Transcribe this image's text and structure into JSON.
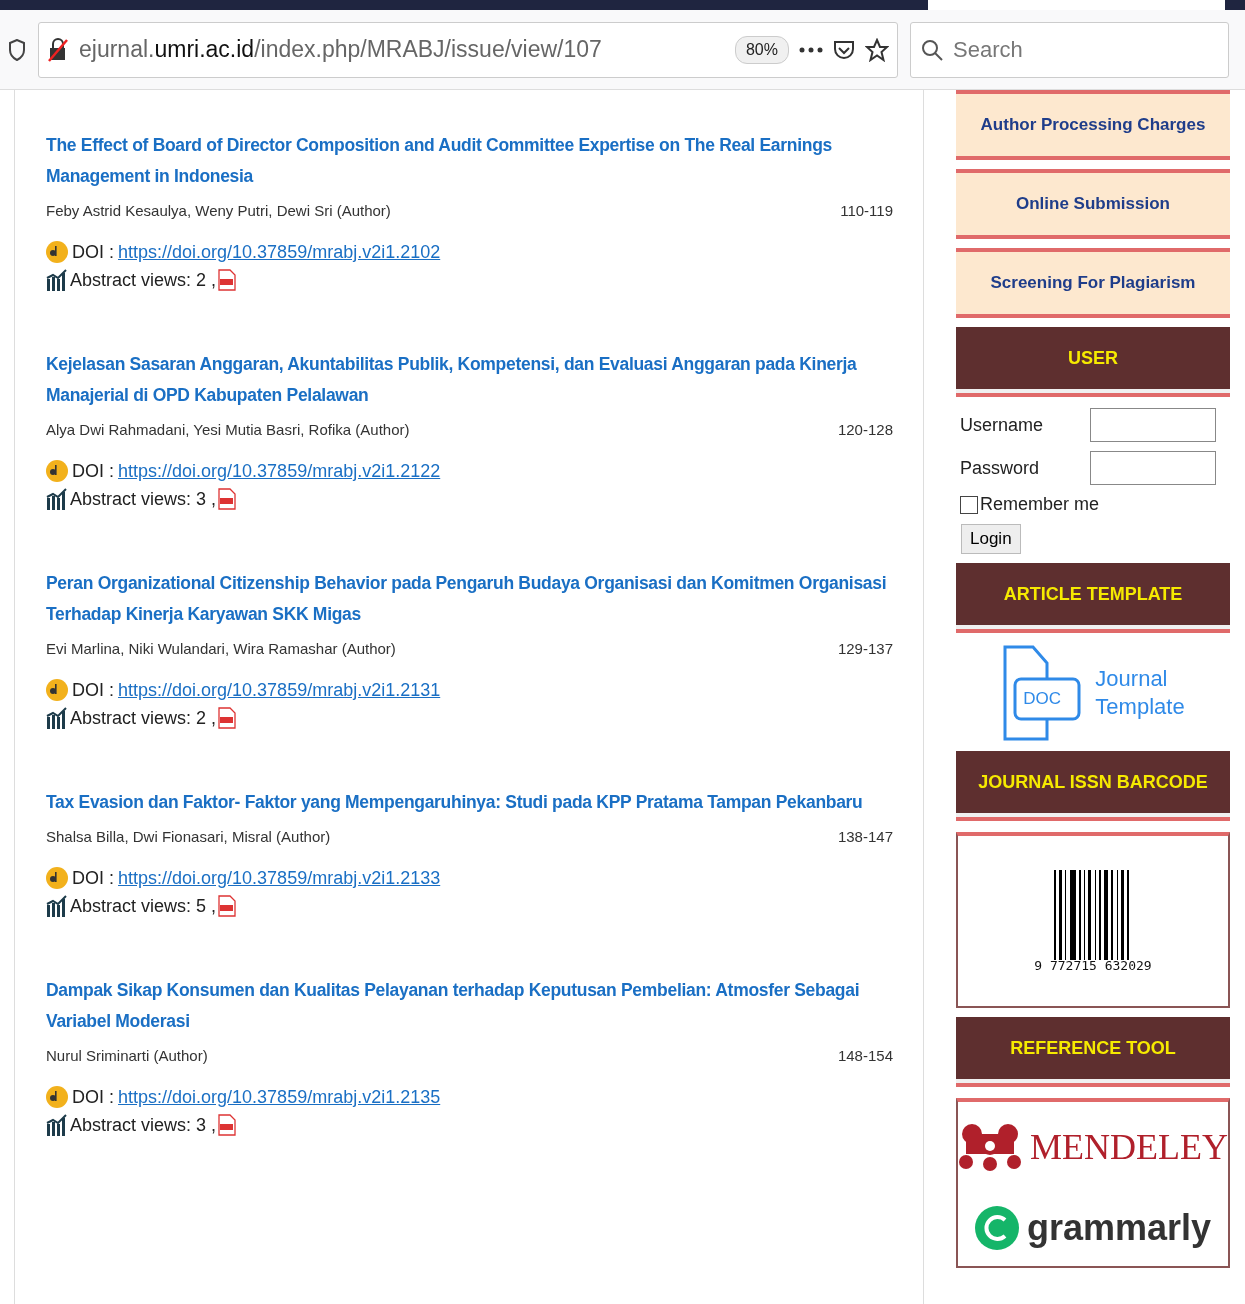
{
  "browser": {
    "url": "ejurnal.**umri.ac.id**/index.php/MRABJ/issue/view/107",
    "zoom": "80%",
    "search": {
      "placeholder": "Search"
    }
  },
  "articles": [
    {
      "title": "The Effect of Board of Director Composition and Audit Committee Expertise on The Real Earnings Management in Indonesia",
      "authors": "Feby Astrid Kesaulya, Weny Putri, Dewi Sri (Author)",
      "pages": "110-119",
      "doi_label": "DOI :",
      "doi_url": "https://doi.org/10.37859/mrabj.v2i1.2102",
      "views": "Abstract views: 2 ,"
    },
    {
      "title": "Kejelasan Sasaran Anggaran, Akuntabilitas Publik, Kompetensi, dan Evaluasi Anggaran pada Kinerja Manajerial di OPD Kabupaten Pelalawan",
      "authors": "Alya Dwi Rahmadani, Yesi Mutia Basri, Rofika (Author)",
      "pages": "120-128",
      "doi_label": "DOI :",
      "doi_url": "https://doi.org/10.37859/mrabj.v2i1.2122",
      "views": "Abstract views: 3 ,"
    },
    {
      "title": "Peran Organizational Citizenship Behavior pada Pengaruh Budaya Organisasi dan Komitmen Organisasi Terhadap Kinerja Karyawan SKK Migas",
      "authors": "Evi Marlina, Niki Wulandari, Wira Ramashar (Author)",
      "pages": "129-137",
      "doi_label": "DOI :",
      "doi_url": "https://doi.org/10.37859/mrabj.v2i1.2131",
      "views": "Abstract views: 2 ,"
    },
    {
      "title": "Tax Evasion dan Faktor- Faktor yang Mempengaruhinya: Studi pada KPP Pratama Tampan Pekanbaru",
      "authors": "Shalsa Billa, Dwi Fionasari, Misral (Author)",
      "pages": "138-147",
      "doi_label": "DOI :",
      "doi_url": "https://doi.org/10.37859/mrabj.v2i1.2133",
      "views": "Abstract views: 5 ,"
    },
    {
      "title": "Dampak Sikap Konsumen dan Kualitas Pelayanan terhadap Keputusan Pembelian: Atmosfer Sebagai Variabel Moderasi",
      "authors": "Nurul Sriminarti (Author)",
      "pages": "148-154",
      "doi_label": "DOI :",
      "doi_url": "https://doi.org/10.37859/mrabj.v2i1.2135",
      "views": "Abstract views: 3 ,"
    }
  ],
  "sidebar": {
    "links": [
      "Author Processing Charges",
      "Online Submission",
      "Screening For Plagiarism"
    ],
    "user": {
      "heading": "USER",
      "username_label": "Username",
      "password_label": "Password",
      "remember": {
        "label": "Remember me",
        "checked": false
      },
      "login_button": "Login"
    },
    "article_template": {
      "heading": "ARTICLE TEMPLATE",
      "doc_badge": "DOC",
      "caption": [
        "Journal",
        "Template"
      ]
    },
    "issn": {
      "heading": "JOURNAL ISSN BARCODE",
      "barcode_number": "9 772715 632029"
    },
    "reference": {
      "heading": "REFERENCE TOOL",
      "logos": [
        "MENDELEY",
        "grammarly"
      ]
    }
  }
}
